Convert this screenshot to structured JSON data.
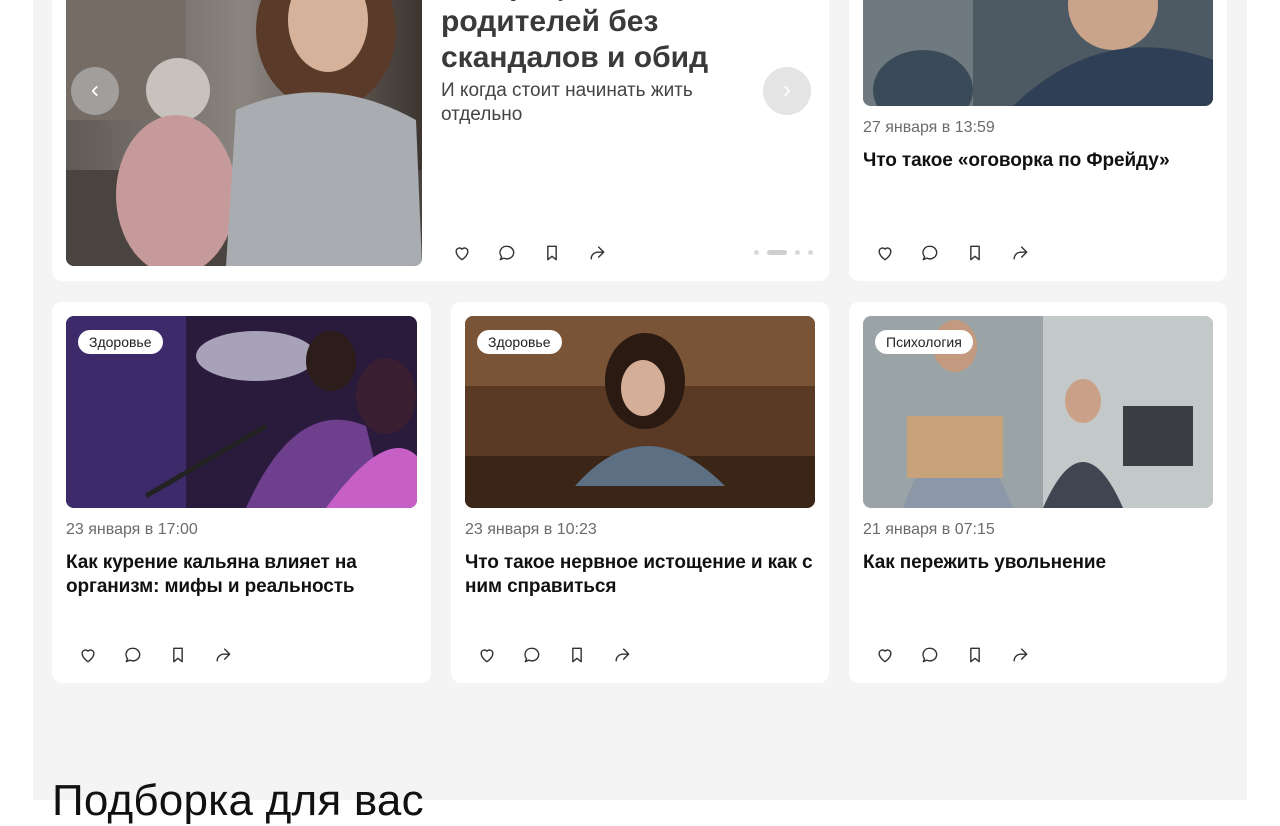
{
  "hero": {
    "title": "сепарацию от родителей без скандалов и обид",
    "subtitle": "И когда стоит начинать жить отдельно"
  },
  "side_card": {
    "date": "27 января в 13:59",
    "title": "Что такое «оговорка по Фрейду»"
  },
  "cards": [
    {
      "tag": "Здоровье",
      "date": "23 января в 17:00",
      "title": "Как курение кальяна влияет на организм: мифы и реальность"
    },
    {
      "tag": "Здоровье",
      "date": "23 января в 10:23",
      "title": "Что такое нервное истощение и как с ним справиться"
    },
    {
      "tag": "Психология",
      "date": "21 января в 07:15",
      "title": "Как пережить увольнение"
    }
  ],
  "section": {
    "heading": "Подборка для вас"
  },
  "icons": [
    "chevron-left-icon",
    "chevron-right-icon",
    "heart-icon",
    "comment-icon",
    "bookmark-icon",
    "share-icon"
  ],
  "colors": {
    "page_bg": "#f4f4f4",
    "card_bg": "#ffffff",
    "date": "#6b6b6b"
  }
}
